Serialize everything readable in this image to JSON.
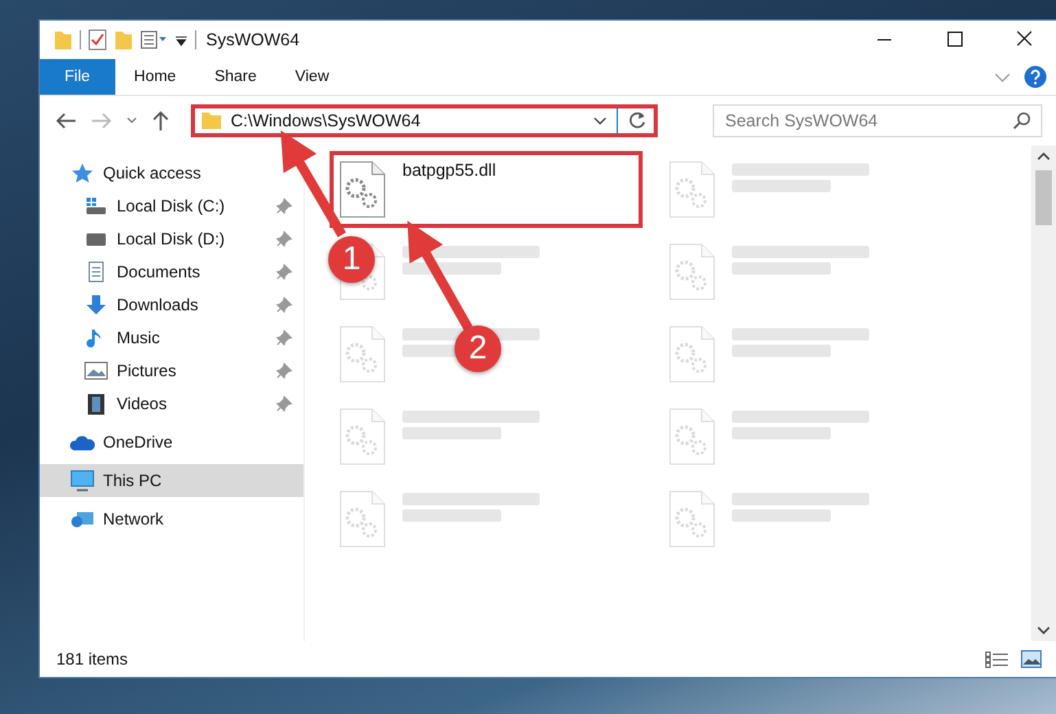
{
  "window": {
    "title": "SysWOW64"
  },
  "ribbon": {
    "tabs": [
      {
        "label": "File",
        "selected": true
      },
      {
        "label": "Home",
        "selected": false
      },
      {
        "label": "Share",
        "selected": false
      },
      {
        "label": "View",
        "selected": false
      }
    ]
  },
  "address": {
    "path": "C:\\Windows\\SysWOW64",
    "highlighted": true
  },
  "search": {
    "placeholder": "Search SysWOW64"
  },
  "sidebar": {
    "items": [
      {
        "label": "Quick access",
        "kind": "star",
        "selected": false,
        "children": [
          {
            "label": "Local Disk (C:)",
            "kind": "drive-win",
            "pinned": true,
            "selected": false
          },
          {
            "label": "Local Disk (D:)",
            "kind": "drive",
            "pinned": true,
            "selected": false
          },
          {
            "label": "Documents",
            "kind": "document",
            "pinned": true,
            "selected": false
          },
          {
            "label": "Downloads",
            "kind": "download",
            "pinned": true,
            "selected": false
          },
          {
            "label": "Music",
            "kind": "music",
            "pinned": true,
            "selected": false
          },
          {
            "label": "Pictures",
            "kind": "picture",
            "pinned": true,
            "selected": false
          },
          {
            "label": "Videos",
            "kind": "video",
            "pinned": true,
            "selected": false
          }
        ]
      },
      {
        "label": "OneDrive",
        "kind": "cloud",
        "selected": false
      },
      {
        "label": "This PC",
        "kind": "computer",
        "selected": true
      },
      {
        "label": "Network",
        "kind": "network",
        "selected": false
      }
    ]
  },
  "files": [
    {
      "name": "batpgp55.dll",
      "highlighted": true,
      "blurred": false
    },
    {
      "highlighted": false,
      "blurred": true
    },
    {
      "highlighted": false,
      "blurred": true
    },
    {
      "highlighted": false,
      "blurred": true
    },
    {
      "highlighted": false,
      "blurred": true
    },
    {
      "highlighted": false,
      "blurred": true
    },
    {
      "highlighted": false,
      "blurred": true
    },
    {
      "highlighted": false,
      "blurred": true
    },
    {
      "highlighted": false,
      "blurred": true
    },
    {
      "highlighted": false,
      "blurred": true
    }
  ],
  "annotations": [
    {
      "label": "1"
    },
    {
      "label": "2"
    }
  ],
  "status_bar": {
    "count": "181 items"
  }
}
